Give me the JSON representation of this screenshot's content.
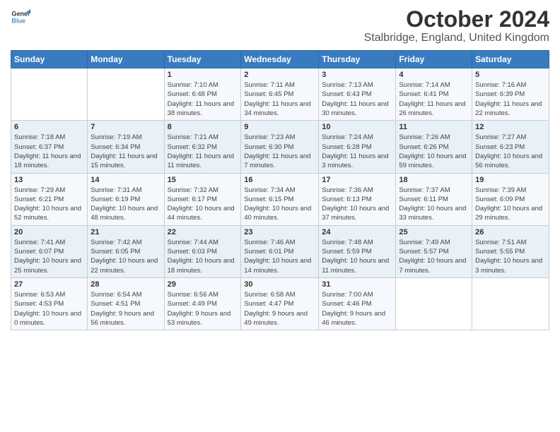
{
  "logo": {
    "line1": "General",
    "line2": "Blue"
  },
  "title": "October 2024",
  "subtitle": "Stalbridge, England, United Kingdom",
  "weekdays": [
    "Sunday",
    "Monday",
    "Tuesday",
    "Wednesday",
    "Thursday",
    "Friday",
    "Saturday"
  ],
  "weeks": [
    [
      {
        "day": "",
        "info": ""
      },
      {
        "day": "",
        "info": ""
      },
      {
        "day": "1",
        "info": "Sunrise: 7:10 AM\nSunset: 6:48 PM\nDaylight: 11 hours and 38 minutes."
      },
      {
        "day": "2",
        "info": "Sunrise: 7:11 AM\nSunset: 6:45 PM\nDaylight: 11 hours and 34 minutes."
      },
      {
        "day": "3",
        "info": "Sunrise: 7:13 AM\nSunset: 6:43 PM\nDaylight: 11 hours and 30 minutes."
      },
      {
        "day": "4",
        "info": "Sunrise: 7:14 AM\nSunset: 6:41 PM\nDaylight: 11 hours and 26 minutes."
      },
      {
        "day": "5",
        "info": "Sunrise: 7:16 AM\nSunset: 6:39 PM\nDaylight: 11 hours and 22 minutes."
      }
    ],
    [
      {
        "day": "6",
        "info": "Sunrise: 7:18 AM\nSunset: 6:37 PM\nDaylight: 11 hours and 18 minutes."
      },
      {
        "day": "7",
        "info": "Sunrise: 7:19 AM\nSunset: 6:34 PM\nDaylight: 11 hours and 15 minutes."
      },
      {
        "day": "8",
        "info": "Sunrise: 7:21 AM\nSunset: 6:32 PM\nDaylight: 11 hours and 11 minutes."
      },
      {
        "day": "9",
        "info": "Sunrise: 7:23 AM\nSunset: 6:30 PM\nDaylight: 11 hours and 7 minutes."
      },
      {
        "day": "10",
        "info": "Sunrise: 7:24 AM\nSunset: 6:28 PM\nDaylight: 11 hours and 3 minutes."
      },
      {
        "day": "11",
        "info": "Sunrise: 7:26 AM\nSunset: 6:26 PM\nDaylight: 10 hours and 59 minutes."
      },
      {
        "day": "12",
        "info": "Sunrise: 7:27 AM\nSunset: 6:23 PM\nDaylight: 10 hours and 56 minutes."
      }
    ],
    [
      {
        "day": "13",
        "info": "Sunrise: 7:29 AM\nSunset: 6:21 PM\nDaylight: 10 hours and 52 minutes."
      },
      {
        "day": "14",
        "info": "Sunrise: 7:31 AM\nSunset: 6:19 PM\nDaylight: 10 hours and 48 minutes."
      },
      {
        "day": "15",
        "info": "Sunrise: 7:32 AM\nSunset: 6:17 PM\nDaylight: 10 hours and 44 minutes."
      },
      {
        "day": "16",
        "info": "Sunrise: 7:34 AM\nSunset: 6:15 PM\nDaylight: 10 hours and 40 minutes."
      },
      {
        "day": "17",
        "info": "Sunrise: 7:36 AM\nSunset: 6:13 PM\nDaylight: 10 hours and 37 minutes."
      },
      {
        "day": "18",
        "info": "Sunrise: 7:37 AM\nSunset: 6:11 PM\nDaylight: 10 hours and 33 minutes."
      },
      {
        "day": "19",
        "info": "Sunrise: 7:39 AM\nSunset: 6:09 PM\nDaylight: 10 hours and 29 minutes."
      }
    ],
    [
      {
        "day": "20",
        "info": "Sunrise: 7:41 AM\nSunset: 6:07 PM\nDaylight: 10 hours and 25 minutes."
      },
      {
        "day": "21",
        "info": "Sunrise: 7:42 AM\nSunset: 6:05 PM\nDaylight: 10 hours and 22 minutes."
      },
      {
        "day": "22",
        "info": "Sunrise: 7:44 AM\nSunset: 6:03 PM\nDaylight: 10 hours and 18 minutes."
      },
      {
        "day": "23",
        "info": "Sunrise: 7:46 AM\nSunset: 6:01 PM\nDaylight: 10 hours and 14 minutes."
      },
      {
        "day": "24",
        "info": "Sunrise: 7:48 AM\nSunset: 5:59 PM\nDaylight: 10 hours and 11 minutes."
      },
      {
        "day": "25",
        "info": "Sunrise: 7:49 AM\nSunset: 5:57 PM\nDaylight: 10 hours and 7 minutes."
      },
      {
        "day": "26",
        "info": "Sunrise: 7:51 AM\nSunset: 5:55 PM\nDaylight: 10 hours and 3 minutes."
      }
    ],
    [
      {
        "day": "27",
        "info": "Sunrise: 6:53 AM\nSunset: 4:53 PM\nDaylight: 10 hours and 0 minutes."
      },
      {
        "day": "28",
        "info": "Sunrise: 6:54 AM\nSunset: 4:51 PM\nDaylight: 9 hours and 56 minutes."
      },
      {
        "day": "29",
        "info": "Sunrise: 6:56 AM\nSunset: 4:49 PM\nDaylight: 9 hours and 53 minutes."
      },
      {
        "day": "30",
        "info": "Sunrise: 6:58 AM\nSunset: 4:47 PM\nDaylight: 9 hours and 49 minutes."
      },
      {
        "day": "31",
        "info": "Sunrise: 7:00 AM\nSunset: 4:46 PM\nDaylight: 9 hours and 46 minutes."
      },
      {
        "day": "",
        "info": ""
      },
      {
        "day": "",
        "info": ""
      }
    ]
  ]
}
